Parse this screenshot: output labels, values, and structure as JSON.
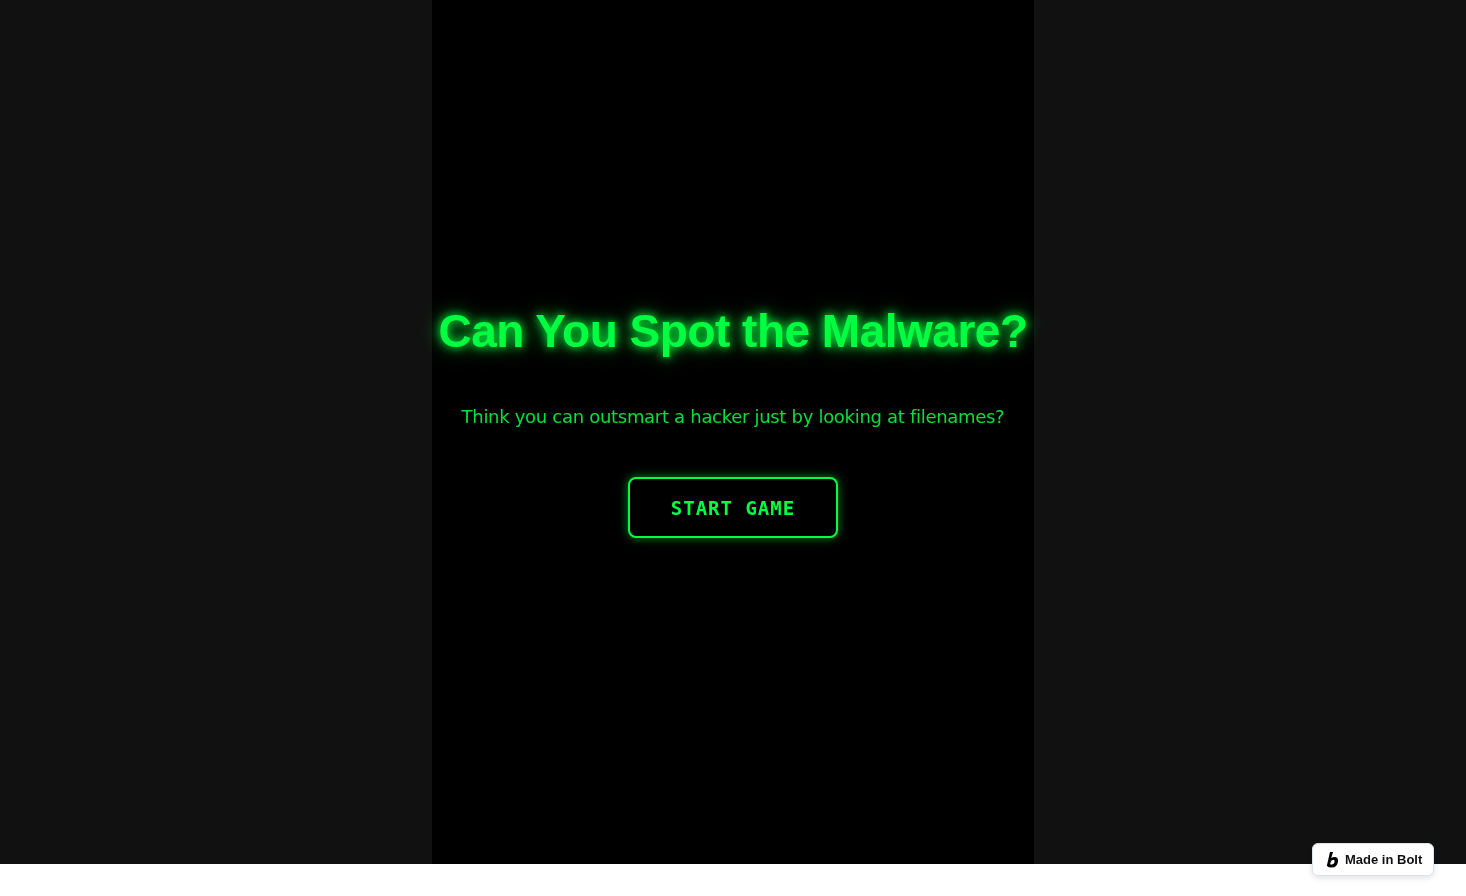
{
  "title": "Can You Spot the Malware?",
  "subtitle": "Think you can outsmart a hacker just by looking at filenames?",
  "start_button": {
    "label": "START GAME"
  },
  "badge": {
    "label": "Made in Bolt"
  }
}
